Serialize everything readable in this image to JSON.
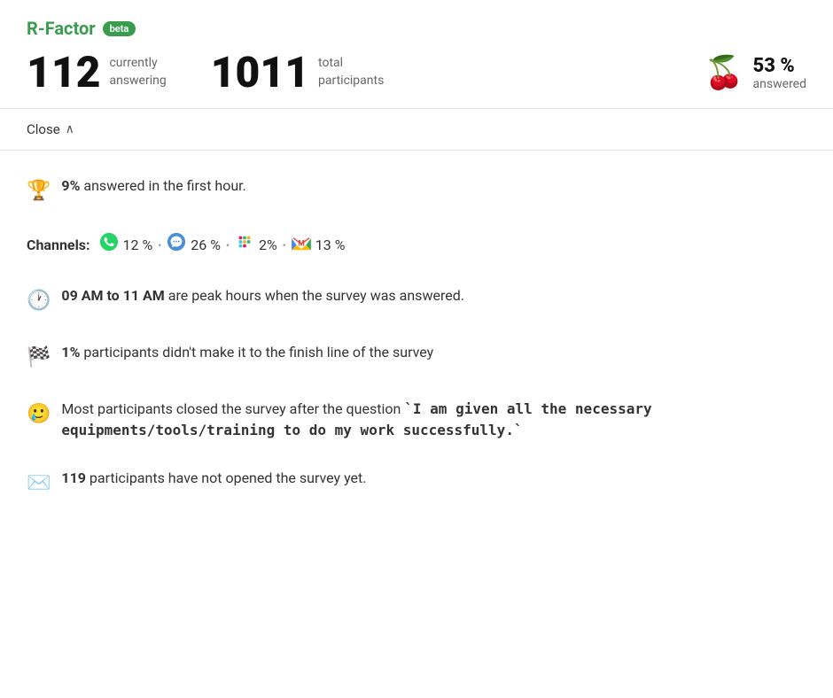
{
  "brand": {
    "name": "R-Factor",
    "badge": "beta"
  },
  "stats": {
    "currently_answering_number": "112",
    "currently_answering_label_line1": "currently",
    "currently_answering_label_line2": "answering",
    "total_participants_number": "1011",
    "total_participants_label_line1": "total",
    "total_participants_label_line2": "participants",
    "answered_percent": "53 %",
    "answered_label": "answered"
  },
  "close_button": "Close",
  "insights": {
    "trophy_text_bold": "9%",
    "trophy_text_rest": " answered in the first hour.",
    "channels_label": "Channels:",
    "channels": [
      {
        "icon": "💬",
        "name": "whatsapp",
        "pct": "12 %"
      },
      {
        "icon": "💬",
        "name": "chat",
        "pct": "26 %"
      },
      {
        "icon": "✳️",
        "name": "slack",
        "pct": "2%"
      },
      {
        "icon": "✉️",
        "name": "gmail",
        "pct": "13 %"
      }
    ],
    "clock_bold": "09 AM to 11 AM",
    "clock_rest": " are peak hours when the survey was answered.",
    "flag_bold": "1%",
    "flag_rest": " participants didn't make it to the finish line of the survey",
    "face_text_pre": "Most participants closed the survey after the question ",
    "face_question_quote": "`I am given all the necessary equipments/tools/training to do my work successfully.`",
    "envelope_bold": "119",
    "envelope_rest": " participants have not opened the survey yet."
  }
}
